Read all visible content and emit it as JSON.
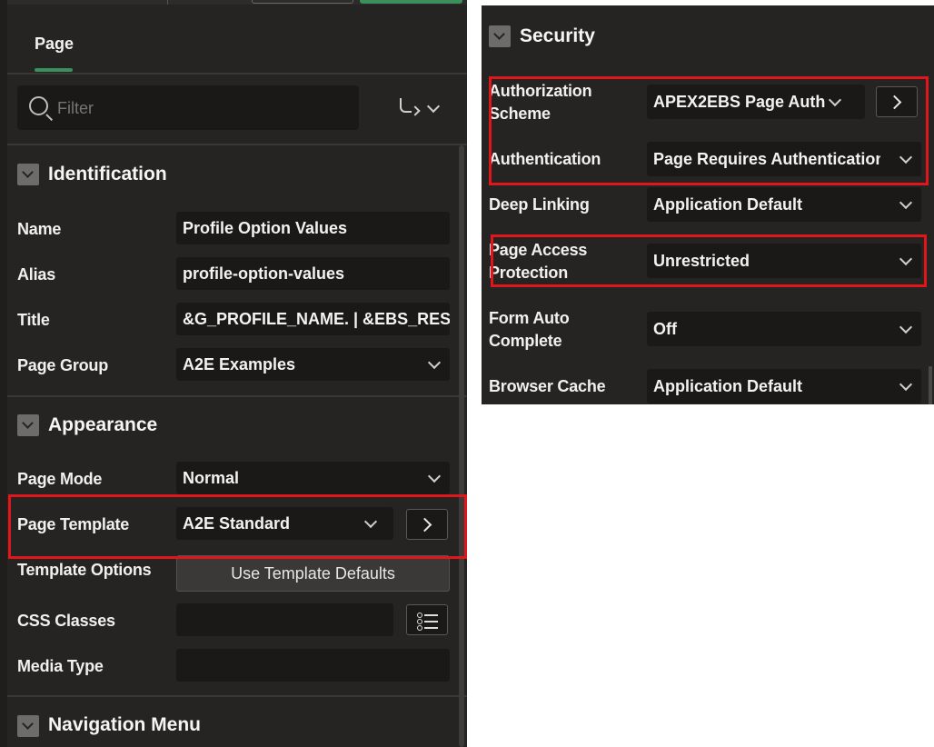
{
  "left_panel": {
    "tab": "Page",
    "filter_placeholder": "Filter",
    "sections": {
      "identification": {
        "title": "Identification",
        "fields": {
          "name": {
            "label": "Name",
            "value": "Profile Option Values"
          },
          "alias": {
            "label": "Alias",
            "value": "profile-option-values"
          },
          "title": {
            "label": "Title",
            "value": "&G_PROFILE_NAME. | &EBS_RESF"
          },
          "page_group": {
            "label": "Page Group",
            "value": "A2E Examples"
          }
        }
      },
      "appearance": {
        "title": "Appearance",
        "fields": {
          "page_mode": {
            "label": "Page Mode",
            "value": "Normal"
          },
          "page_template": {
            "label": "Page Template",
            "value": "A2E Standard"
          },
          "template_options": {
            "label": "Template Options",
            "value": "Use Template Defaults"
          },
          "css_classes": {
            "label": "CSS Classes",
            "value": ""
          },
          "media_type": {
            "label": "Media Type",
            "value": ""
          }
        }
      },
      "navigation_menu": {
        "title": "Navigation Menu"
      }
    }
  },
  "right_panel": {
    "section_title": "Security",
    "fields": {
      "authorization_scheme": {
        "label_line1": "Authorization",
        "label_line2": "Scheme",
        "value": "APEX2EBS Page Auth"
      },
      "authentication": {
        "label": "Authentication",
        "value": "Page Requires Authentication"
      },
      "deep_linking": {
        "label": "Deep Linking",
        "value": "Application Default"
      },
      "page_access_protection": {
        "label_line1": "Page Access",
        "label_line2": "Protection",
        "value": "Unrestricted"
      },
      "form_auto_complete": {
        "label_line1": "Form Auto",
        "label_line2": "Complete",
        "value": "Off"
      },
      "browser_cache": {
        "label": "Browser Cache",
        "value": "Application Default"
      }
    }
  },
  "colors": {
    "highlight": "#e0161b",
    "panel_bg": "#262423",
    "field_bg": "#1a1918",
    "accent": "#3a8f5a"
  }
}
